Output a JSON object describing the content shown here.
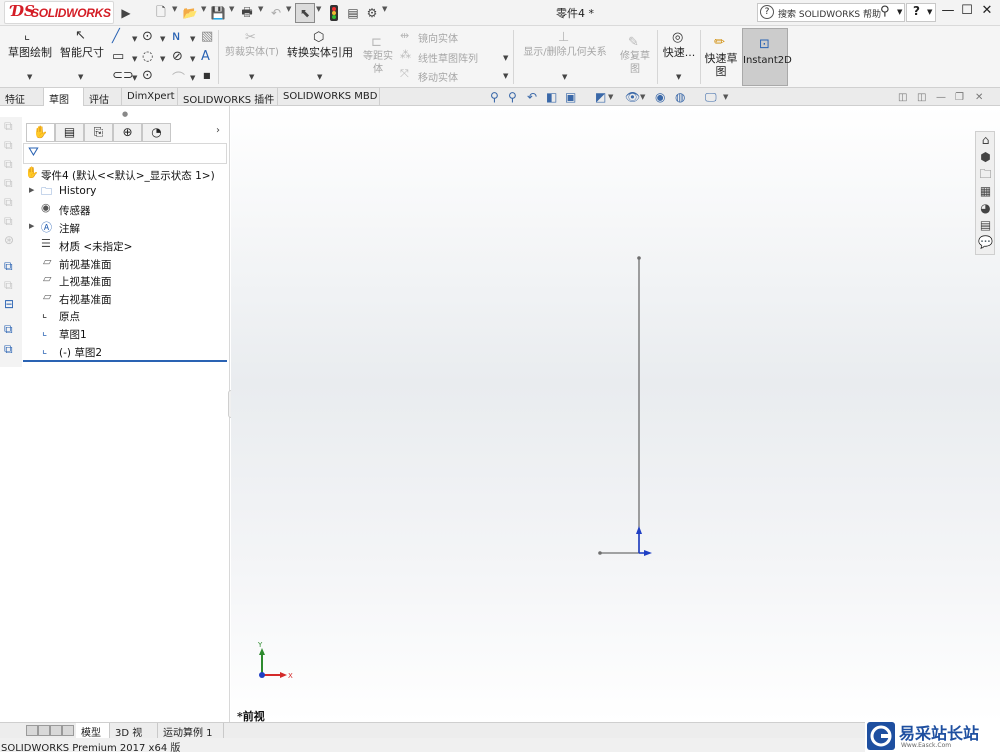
{
  "app": {
    "brand": "SOLIDWORKS",
    "document_title": "零件4 *",
    "help_search": "搜索 SOLIDWORKS 帮助",
    "help_label": "?"
  },
  "ribbon": {
    "sketch": "草图绘制",
    "smart_dim": "智能尺寸",
    "trim": "剪裁实体(T)",
    "convert": "转换实体引用",
    "offset": "等距实体",
    "mirror": "镜向实体",
    "linear_pattern": "线性草图阵列",
    "move": "移动实体",
    "display_relations": "显示/删除几何关系",
    "repair": "修复草图",
    "quick_snap": "快速...",
    "rapid_sketch": "快速草图",
    "instant2d": "Instant2D"
  },
  "tabs": [
    "特征",
    "草图",
    "评估",
    "DimXpert",
    "SOLIDWORKS 插件",
    "SOLIDWORKS MBD"
  ],
  "active_tab": "草图",
  "feature_tree": {
    "root": "零件4 (默认<<默认>_显示状态 1>)",
    "items": [
      {
        "label": "History",
        "icon": "history-folder-icon",
        "expandable": true
      },
      {
        "label": "传感器",
        "icon": "sensor-icon",
        "expandable": false
      },
      {
        "label": "注解",
        "icon": "annotation-icon",
        "expandable": true
      },
      {
        "label": "材质 <未指定>",
        "icon": "material-icon",
        "expandable": false
      },
      {
        "label": "前视基准面",
        "icon": "plane-icon",
        "expandable": false
      },
      {
        "label": "上视基准面",
        "icon": "plane-icon",
        "expandable": false
      },
      {
        "label": "右视基准面",
        "icon": "plane-icon",
        "expandable": false
      },
      {
        "label": "原点",
        "icon": "origin-icon",
        "expandable": false
      },
      {
        "label": "草图1",
        "icon": "sketch-icon",
        "expandable": false
      },
      {
        "label": "(-) 草图2",
        "icon": "sketch-icon",
        "expandable": false
      }
    ]
  },
  "graphics": {
    "view_name": "*前视",
    "triad_x": "X",
    "triad_y": "Y"
  },
  "bottom_tabs": [
    "模型",
    "3D 视图",
    "运动算例 1"
  ],
  "active_bottom_tab": "模型",
  "status": "SOLIDWORKS Premium 2017 x64 版",
  "watermark": {
    "name": "易采站长站",
    "url": "Www.Easck.Com"
  },
  "colors": {
    "accent": "#2a63b3",
    "brand_red": "#d41d26",
    "sketch_line": "#6f6f6f",
    "axis_blue": "#1f3fc4",
    "triad_red": "#d42a2a",
    "triad_green": "#2e8b2e"
  }
}
